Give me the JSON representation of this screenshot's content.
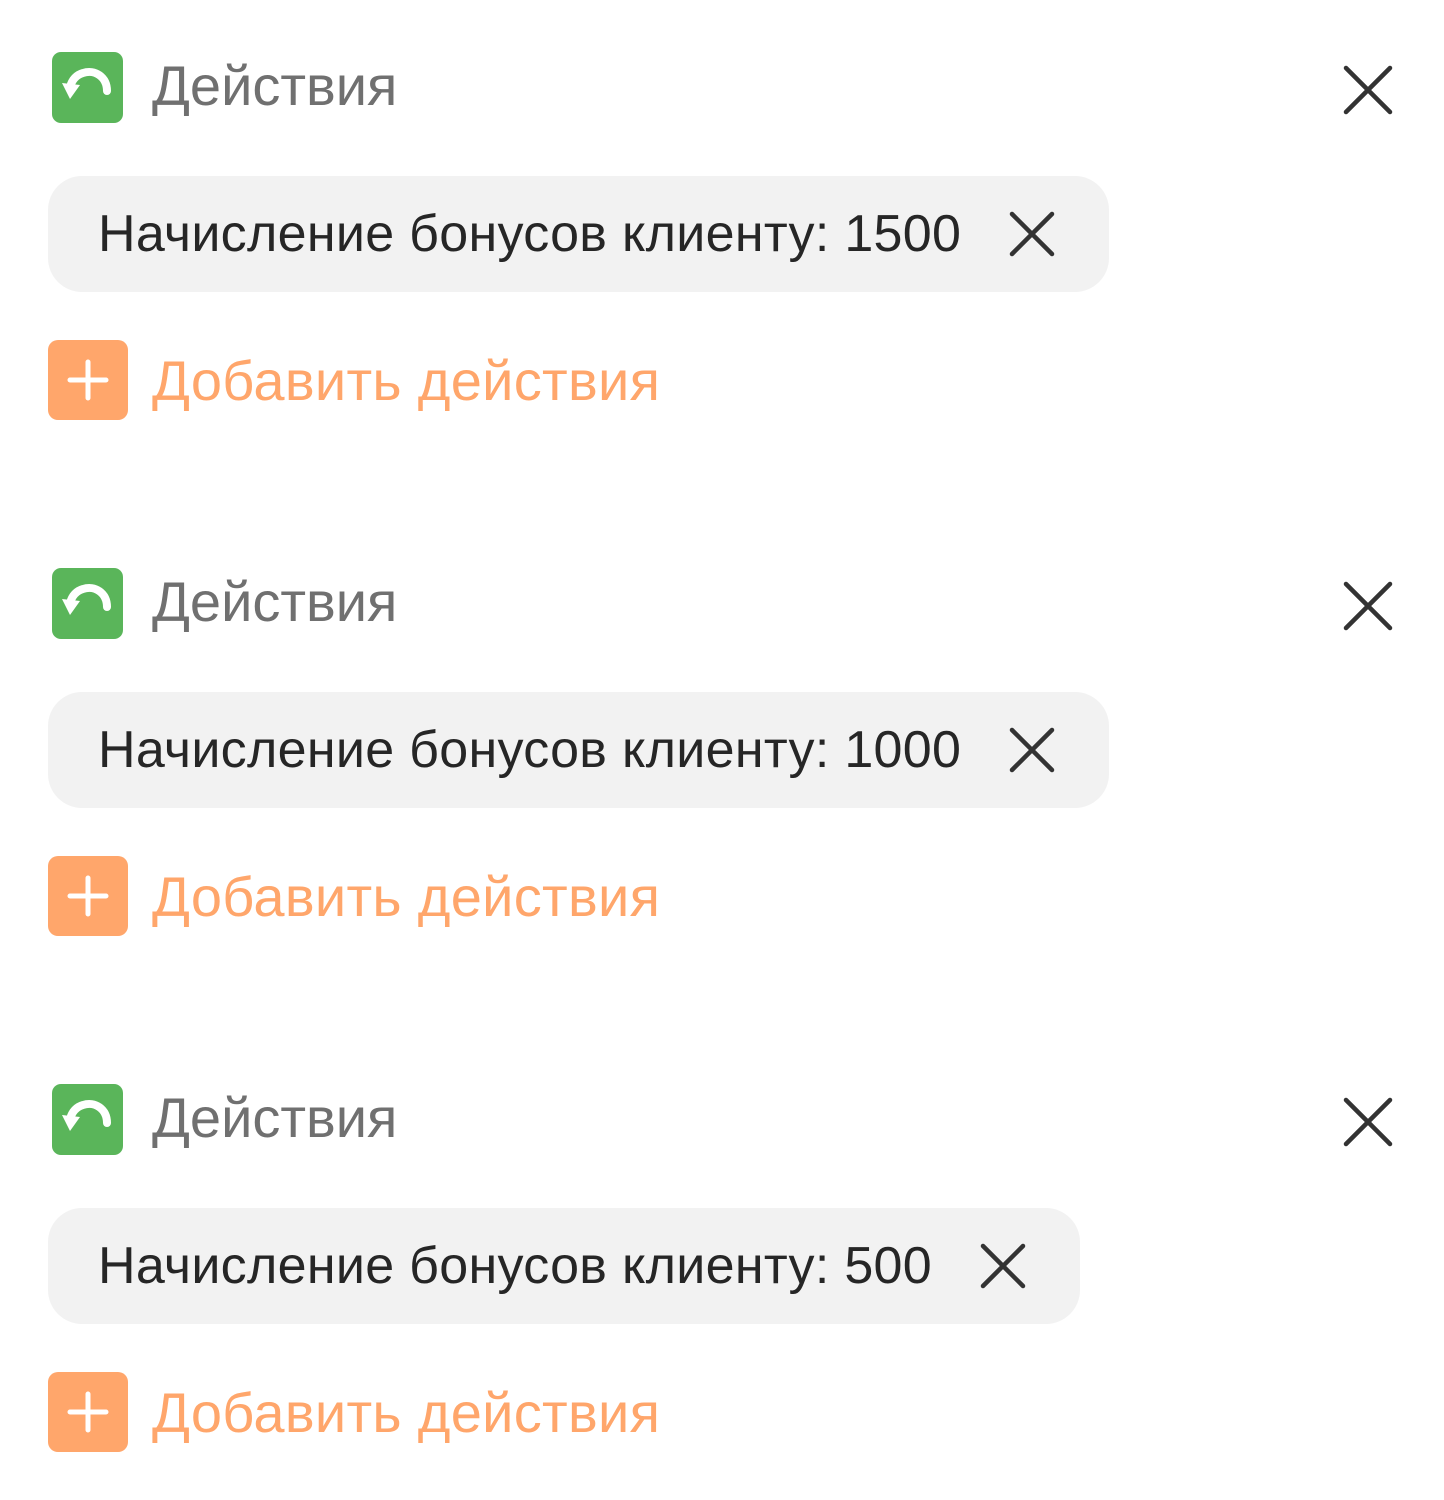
{
  "colors": {
    "header_icon_bg": "#5ab55a",
    "header_text": "#707070",
    "chip_bg": "#f2f2f2",
    "chip_text": "#262626",
    "accent_orange": "#ffa66b",
    "close_icon": "#333333"
  },
  "blocks": [
    {
      "header": {
        "title": "Действия",
        "icon": "undo-arrow-icon"
      },
      "close_icon": "close-icon",
      "action_chip": {
        "label": "Начисление бонусов клиенту: 1500",
        "remove_icon": "close-icon"
      },
      "add_action": {
        "label": "Добавить действия",
        "icon": "plus-icon"
      }
    },
    {
      "header": {
        "title": "Действия",
        "icon": "undo-arrow-icon"
      },
      "close_icon": "close-icon",
      "action_chip": {
        "label": "Начисление бонусов клиенту: 1000",
        "remove_icon": "close-icon"
      },
      "add_action": {
        "label": "Добавить действия",
        "icon": "plus-icon"
      }
    },
    {
      "header": {
        "title": "Действия",
        "icon": "undo-arrow-icon"
      },
      "close_icon": "close-icon",
      "action_chip": {
        "label": "Начисление бонусов клиенту: 500",
        "remove_icon": "close-icon"
      },
      "add_action": {
        "label": "Добавить действия",
        "icon": "plus-icon"
      }
    }
  ]
}
